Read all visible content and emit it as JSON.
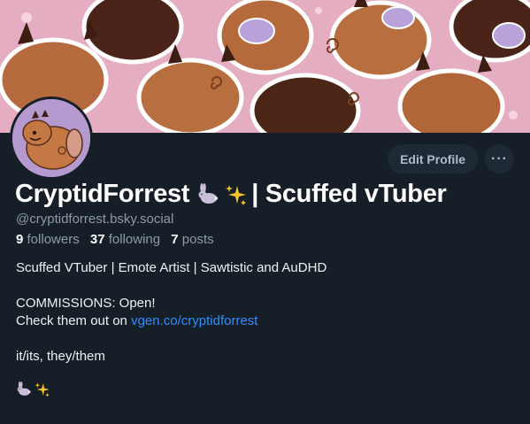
{
  "profile": {
    "display_name": "CryptidForrest",
    "display_name_suffix": "| Scuffed vTuber",
    "handle": "@cryptidforrest.bsky.social",
    "followers_count": "9",
    "followers_label": "followers",
    "following_count": "37",
    "following_label": "following",
    "posts_count": "7",
    "posts_label": "posts"
  },
  "actions": {
    "edit_label": "Edit Profile",
    "more_label": "···"
  },
  "bio": {
    "line1": "Scuffed VTuber | Emote Artist | Sawtistic and AuDHD",
    "line2": "COMMISSIONS: Open!",
    "line3_prefix": "Check them out on ",
    "line3_link": "vgen.co/cryptidforrest",
    "line4": "it/its, they/them"
  },
  "icons": {
    "name_emoji_1": "rabbit-emoji-icon",
    "name_emoji_2": "sparkles-emoji-icon"
  },
  "colors": {
    "background": "#161e27",
    "link": "#2f8cff",
    "muted": "#8d9aa9"
  }
}
